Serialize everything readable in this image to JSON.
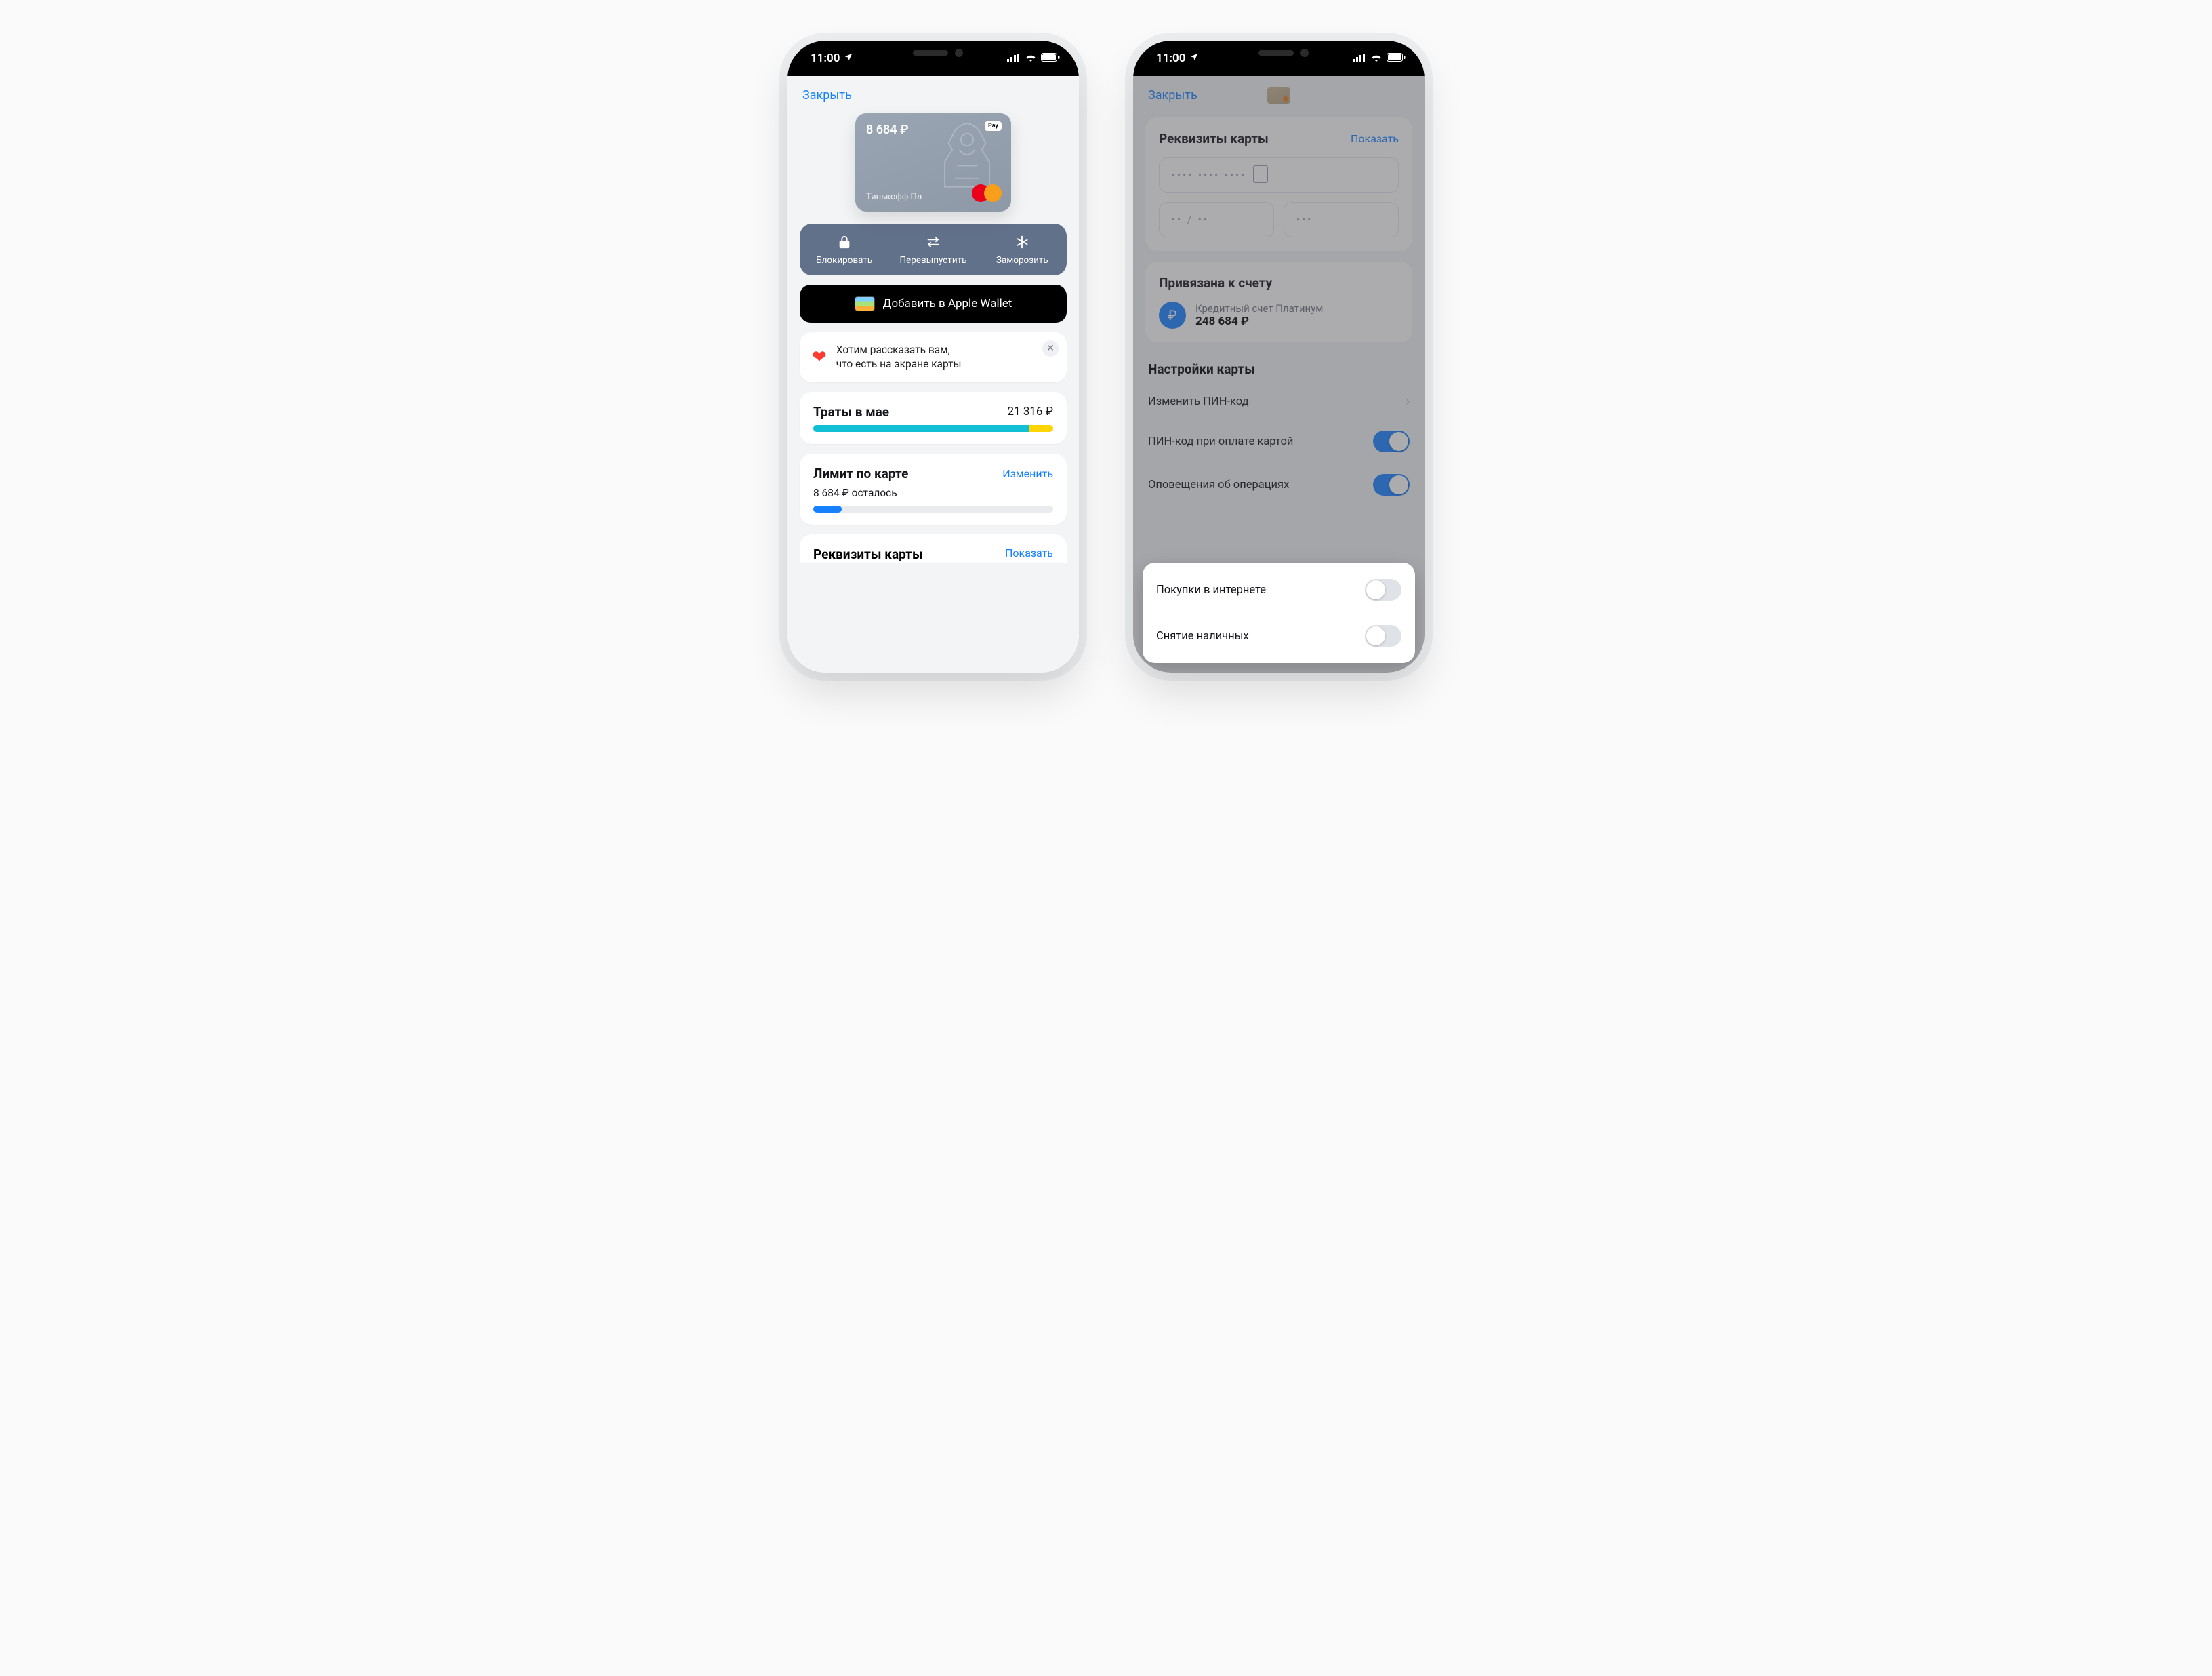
{
  "status": {
    "time": "11:00"
  },
  "screen1": {
    "close": "Закрыть",
    "card": {
      "balance": "8 684 ₽",
      "apple_pay": "Pay",
      "name": "Тинькофф Пл"
    },
    "actions": {
      "block": "Блокировать",
      "reissue": "Перевыпустить",
      "freeze": "Заморозить"
    },
    "wallet_btn": "Добавить в Apple Wallet",
    "tip": {
      "line1": "Хотим рассказать вам,",
      "line2": "что есть на экране карты"
    },
    "spend": {
      "title": "Траты в мае",
      "amount": "21 316 ₽"
    },
    "limit": {
      "title": "Лимит по карте",
      "change": "Изменить",
      "left": "8 684 ₽ осталось"
    },
    "requisites_peek": {
      "title": "Реквизиты карты",
      "show": "Показать"
    }
  },
  "screen2": {
    "close": "Закрыть",
    "requisites": {
      "title": "Реквизиты карты",
      "show": "Показать",
      "pan": "•••• •••• ••••",
      "exp": "•• / ••",
      "cvc": "•••"
    },
    "linked": {
      "title": "Привязана к счету",
      "account_name": "Кредитный счет Платинум",
      "account_balance": "248 684 ₽"
    },
    "settings": {
      "title": "Настройки карты",
      "change_pin": "Изменить ПИН-код",
      "pin_on_pay": "ПИН-код при оплате картой",
      "notify": "Оповещения об операциях",
      "online": "Покупки в интернете",
      "cash": "Снятие наличных"
    }
  }
}
